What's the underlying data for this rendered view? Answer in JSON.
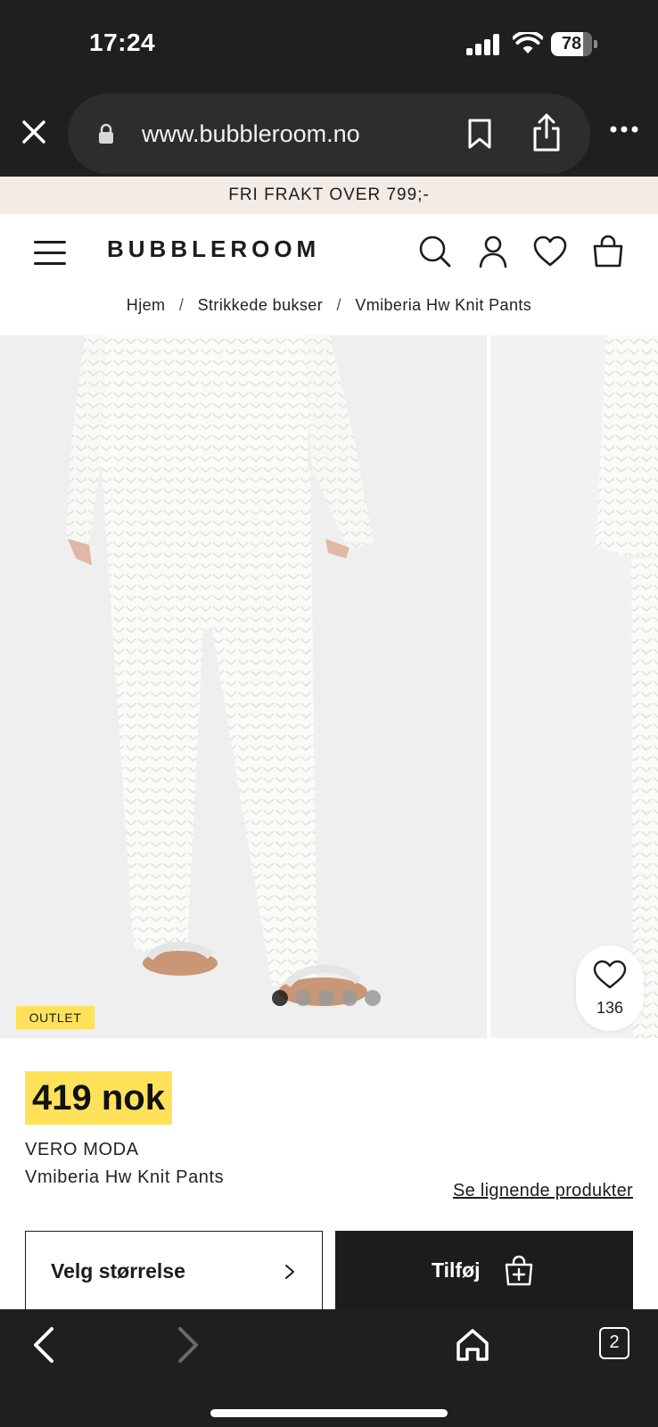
{
  "status_bar": {
    "time": "17:24",
    "battery": "78",
    "battery_level": 0.78,
    "icons": [
      "signal-icon",
      "wifi-icon",
      "battery-icon"
    ]
  },
  "browser": {
    "url": "www.bubbleroom.no",
    "icons": [
      "close-icon",
      "lock-icon",
      "bookmark-icon",
      "share-icon",
      "more-icon"
    ]
  },
  "promo": {
    "text": "FRI FRAKT OVER 799;-"
  },
  "header": {
    "logo": "BUBBLEROOM",
    "icons": [
      "menu-icon",
      "search-icon",
      "account-icon",
      "heart-icon",
      "bag-icon"
    ]
  },
  "breadcrumb": {
    "items": [
      "Hjem",
      "Strikkede bukser",
      "Vmiberia Hw Knit Pants"
    ],
    "separator": "/"
  },
  "gallery": {
    "badge": "OUTLET",
    "dots_total": 5,
    "dots_active_index": 0,
    "wishlist_count": "136"
  },
  "product": {
    "price": "419 nok",
    "brand": "VERO MODA",
    "name": "Vmiberia Hw Knit Pants",
    "similar_link": "Se lignende produkter",
    "size_button": "Velg størrelse",
    "add_button": "Tilføj"
  },
  "toolbar": {
    "tabs_count": "2",
    "icons": [
      "back-icon",
      "forward-icon",
      "home-icon",
      "tabs-icon"
    ]
  },
  "colors": {
    "accent_yellow": "#ffe25a",
    "promo_bg": "#f3ebe6",
    "dark": "#1f1f1f"
  }
}
